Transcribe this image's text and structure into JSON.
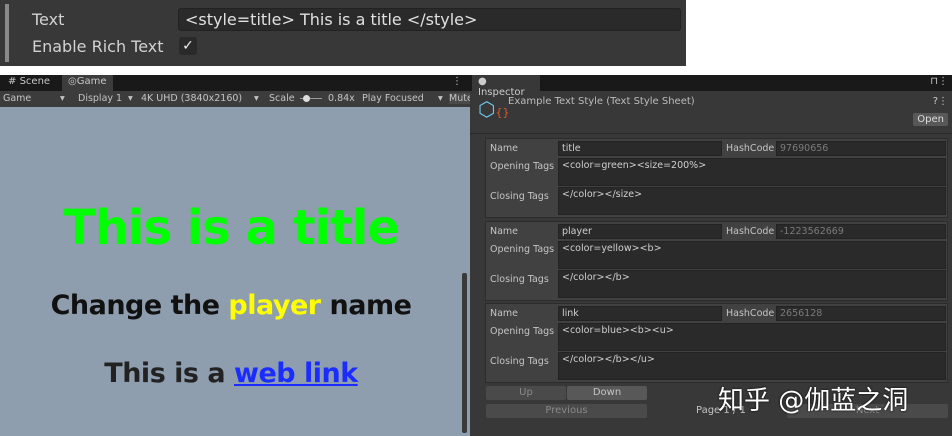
{
  "top_panel": {
    "text_label": "Text",
    "text_value": "<style=title> This is a title </style>",
    "rich_label": "Enable Rich Text",
    "rich_checked": true
  },
  "game": {
    "tabs": [
      "Scene",
      "Game"
    ],
    "toolbar": {
      "mode": "Game",
      "display": "Display 1",
      "resolution": "4K UHD (3840x2160)",
      "scale_label": "Scale",
      "scale_value": "0.84x",
      "play": "Play Focused",
      "mute": "Mute"
    },
    "line1": "This is a title",
    "line2_a": "Change the ",
    "line2_b": "player",
    "line2_c": " name",
    "line3_a": "This is a ",
    "line3_b": " web link",
    "colors": {
      "title": "#00ff00",
      "player": "#ffff00",
      "link": "#0000ff",
      "bg": "#8e9eae"
    }
  },
  "inspector": {
    "tab": "Inspector",
    "title": "Example Text Style (Text Style Sheet)",
    "open": "Open",
    "labels": {
      "name": "Name",
      "hash": "HashCode",
      "opening": "Opening Tags",
      "closing": "Closing Tags"
    },
    "styles": [
      {
        "name": "title",
        "hash": "97690656",
        "opening": "<color=green><size=200%>",
        "closing": "</color></size>"
      },
      {
        "name": "player",
        "hash": "-1223562669",
        "opening": "<color=yellow><b>",
        "closing": "</color></b>"
      },
      {
        "name": "link",
        "hash": "2656128",
        "opening": "<color=blue><b><u>",
        "closing": "</color></b></u>"
      }
    ],
    "up": "Up",
    "down": "Down",
    "previous": "Previous",
    "page": "Page 1 / 1",
    "next": "Next"
  },
  "watermark": "知乎 @伽蓝之洞"
}
